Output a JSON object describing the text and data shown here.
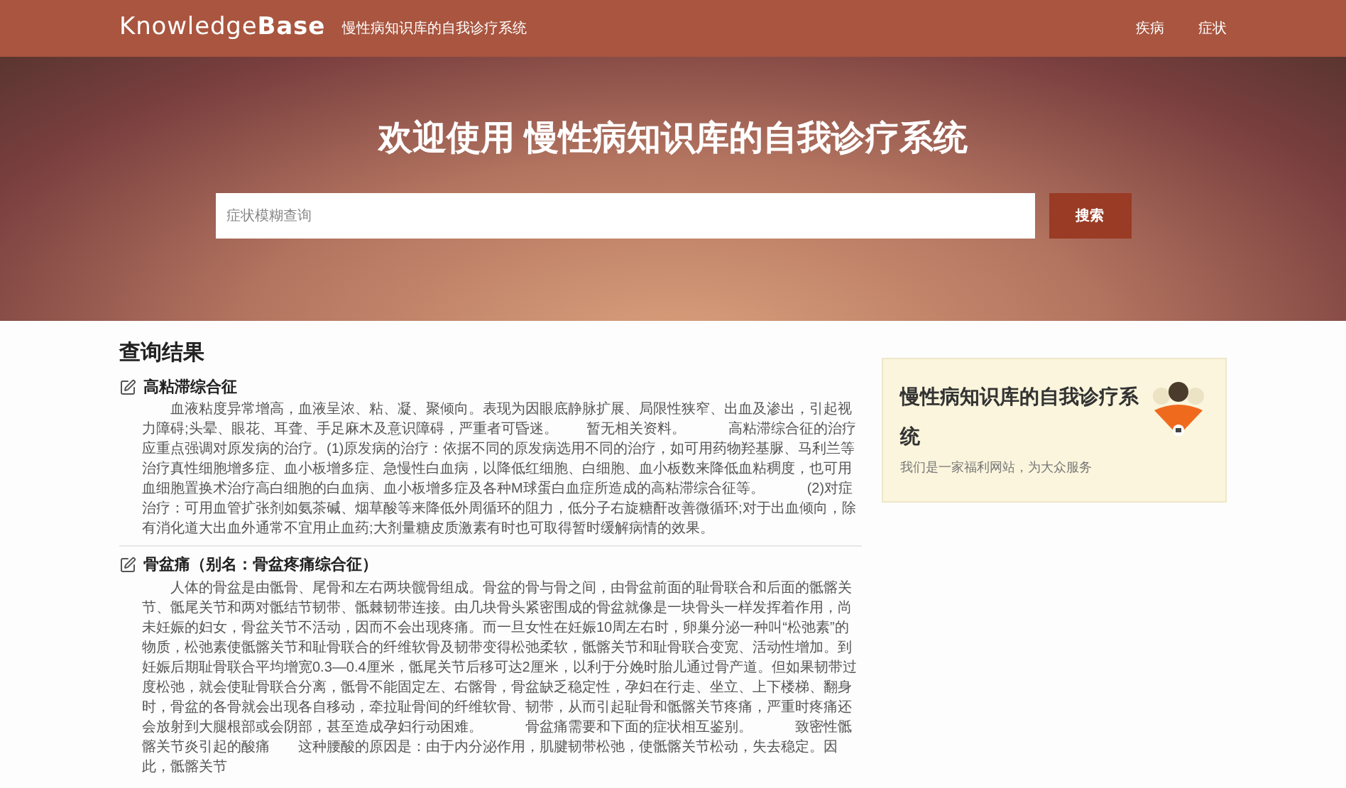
{
  "navbar": {
    "brand": "Knowledge**Base**",
    "subtitle": "慢性病知识库的自我诊疗系统",
    "links": [
      "疾病",
      "症状"
    ]
  },
  "hero": {
    "title": "欢迎使用 慢性病知识库的自我诊疗系统",
    "search": {
      "placeholder": "症状模糊查询"
    },
    "search_button": "搜索"
  },
  "results": {
    "heading": "查询结果",
    "items": [
      {
        "title": "高粘滞综合征",
        "description": "血液粘度异常增高，血液呈浓、粘、凝、聚倾向。表现为因眼底静脉扩展、局限性狭窄、出血及渗出，引起视力障碍;头晕、眼花、耳聋、手足麻木及意识障碍，严重者可昏迷。　　暂无相关资料。　　　高粘滞综合征的治疗应重点强调对原发病的治疗。(1)原发病的治疗：依据不同的原发病选用不同的治疗，如可用药物羟基脲、马利兰等治疗真性细胞增多症、血小板增多症、急慢性白血病，以降低红细胞、白细胞、血小板数来降低血粘稠度，也可用血细胞置换术治疗高白细胞的白血病、血小板增多症及各种M球蛋白血症所造成的高粘滞综合征等。　　　(2)对症治疗：可用血管扩张剂如氨茶碱、烟草酸等来降低外周循环的阻力，低分子右旋糖酐改善微循环;对于出血倾向，除有消化道大出血外通常不宜用止血药;大剂量糖皮质激素有时也可取得暂时缓解病情的效果。"
      },
      {
        "title": "骨盆痛（别名：骨盆疼痛综合征）",
        "description": "人体的骨盆是由骶骨、尾骨和左右两块髋骨组成。骨盆的骨与骨之间，由骨盆前面的耻骨联合和后面的骶髂关节、骶尾关节和两对骶结节韧带、骶棘韧带连接。由几块骨头紧密围成的骨盆就像是一块骨头一样发挥着作用，尚未妊娠的妇女，骨盆关节不活动，因而不会出现疼痛。而一旦女性在妊娠10周左右时，卵巢分泌一种叫“松弛素”的物质，松弛素使骶髂关节和耻骨联合的纤维软骨及韧带变得松弛柔软，骶髂关节和耻骨联合变宽、活动性增加。到妊娠后期耻骨联合平均增宽0.3—0.4厘米，骶尾关节后移可达2厘米，以利于分娩时胎儿通过骨产道。但如果韧带过度松弛，就会使耻骨联合分离，骶骨不能固定左、右髂骨，骨盆缺乏稳定性，孕妇在行走、坐立、上下楼梯、翻身时，骨盆的各骨就会出现各自移动，牵拉耻骨间的纤维软骨、韧带，从而引起耻骨和骶髂关节疼痛，严重时疼痛还会放射到大腿根部或会阴部，甚至造成孕妇行动困难。　　　骨盆痛需要和下面的症状相互鉴别。　　　致密性骶髂关节炎引起的酸痛　　这种腰酸的原因是：由于内分泌作用，肌腱韧带松弛，使骶髂关节松动，失去稳定。因此，骶髂关节"
      }
    ]
  },
  "sidebar": {
    "title": "慢性病知识库的自我诊疗系统",
    "subtitle": "我们是一家福利网站，为大众服务"
  }
}
